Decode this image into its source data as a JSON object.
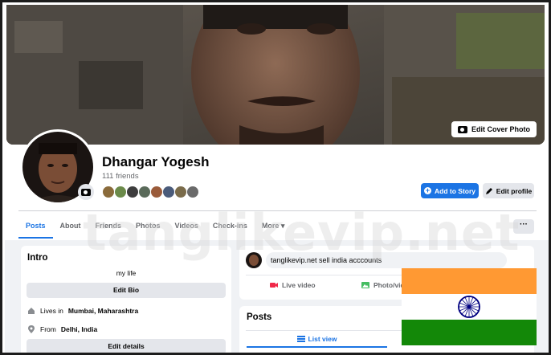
{
  "cover": {
    "edit_label": "Edit Cover Photo"
  },
  "profile": {
    "name": "Dhangar Yogesh",
    "friends": "111 friends",
    "add_story": "Add to Story",
    "edit_profile": "Edit profile",
    "more_dots": "···"
  },
  "tabs": [
    {
      "label": "Posts"
    },
    {
      "label": "About"
    },
    {
      "label": "Friends"
    },
    {
      "label": "Photos"
    },
    {
      "label": "Videos"
    },
    {
      "label": "Check-ins"
    },
    {
      "label": "More ▾"
    }
  ],
  "intro": {
    "title": "Intro",
    "bio": "my life",
    "edit_bio": "Edit Bio",
    "lives_prefix": "Lives in",
    "lives_place": "Mumbai, Maharashtra",
    "from_prefix": "From",
    "from_place": "Delhi, India",
    "edit_details": "Edit details"
  },
  "composer": {
    "text": "tanglikevip.net sell india acccounts",
    "live_video": "Live video",
    "photo_video": "Photo/vid"
  },
  "posts": {
    "title": "Posts",
    "list_view": "List view"
  },
  "watermark": "tanglikevip.net",
  "colors": {
    "accent": "#1b74e4",
    "saffron": "#ff9933",
    "green": "#138808",
    "chakra": "#000080"
  }
}
